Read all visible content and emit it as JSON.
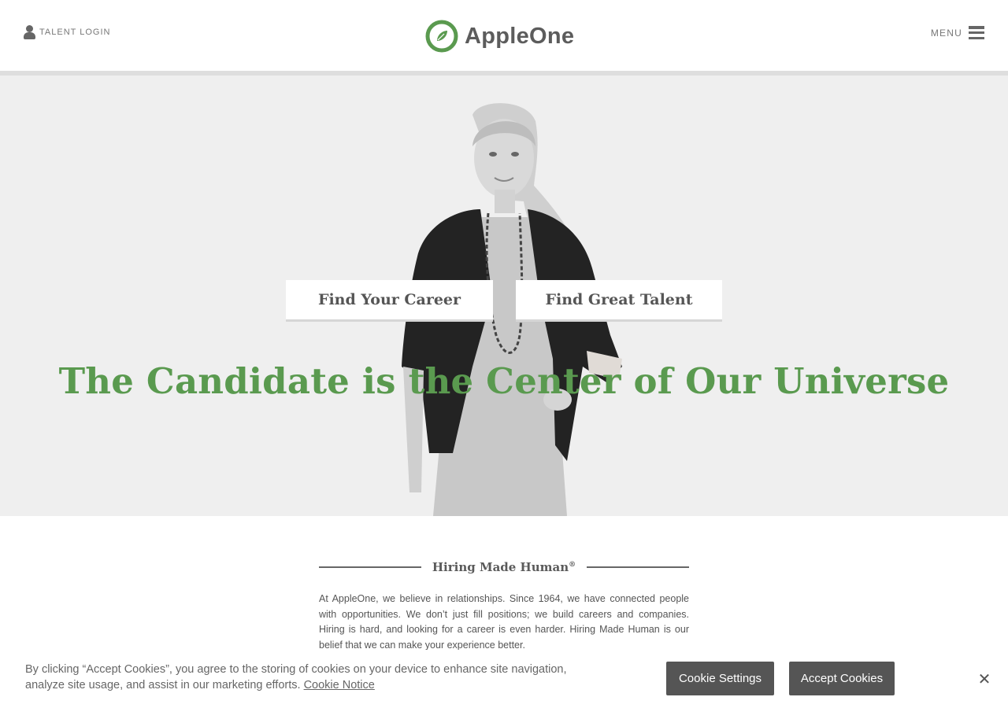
{
  "header": {
    "talent_login_label": "TALENT LOGIN",
    "logo_text": "AppleOne",
    "menu_label": "MENU"
  },
  "hero": {
    "cta_career": "Find Your Career",
    "cta_talent": "Find Great Talent",
    "headline": "The Candidate is the Center of Our Universe"
  },
  "intro": {
    "title": "Hiring Made Human",
    "title_mark": "®",
    "body": "At AppleOne, we believe in relationships. Since 1964, we have connected people with opportunities. We don’t just fill positions; we build careers and companies. Hiring is hard, and looking for a career is even harder. Hiring Made Human is our belief that we can make your experience better."
  },
  "cookie_banner": {
    "text": "By clicking “Accept Cookies”, you agree to the storing of cookies on your device to enhance site navigation, analyze site usage, and assist in our marketing efforts.",
    "notice_link": "Cookie Notice",
    "settings_label": "Cookie Settings",
    "accept_label": "Accept Cookies",
    "close_glyph": "✕"
  },
  "colors": {
    "brand_green": "#5a9a4f",
    "button_dark": "#555555",
    "hero_background": "#efefef"
  },
  "icons": {
    "talent_login": "person-icon",
    "menu": "hamburger-icon",
    "logo": "apple-leaf-logo-icon",
    "close": "close-icon"
  }
}
